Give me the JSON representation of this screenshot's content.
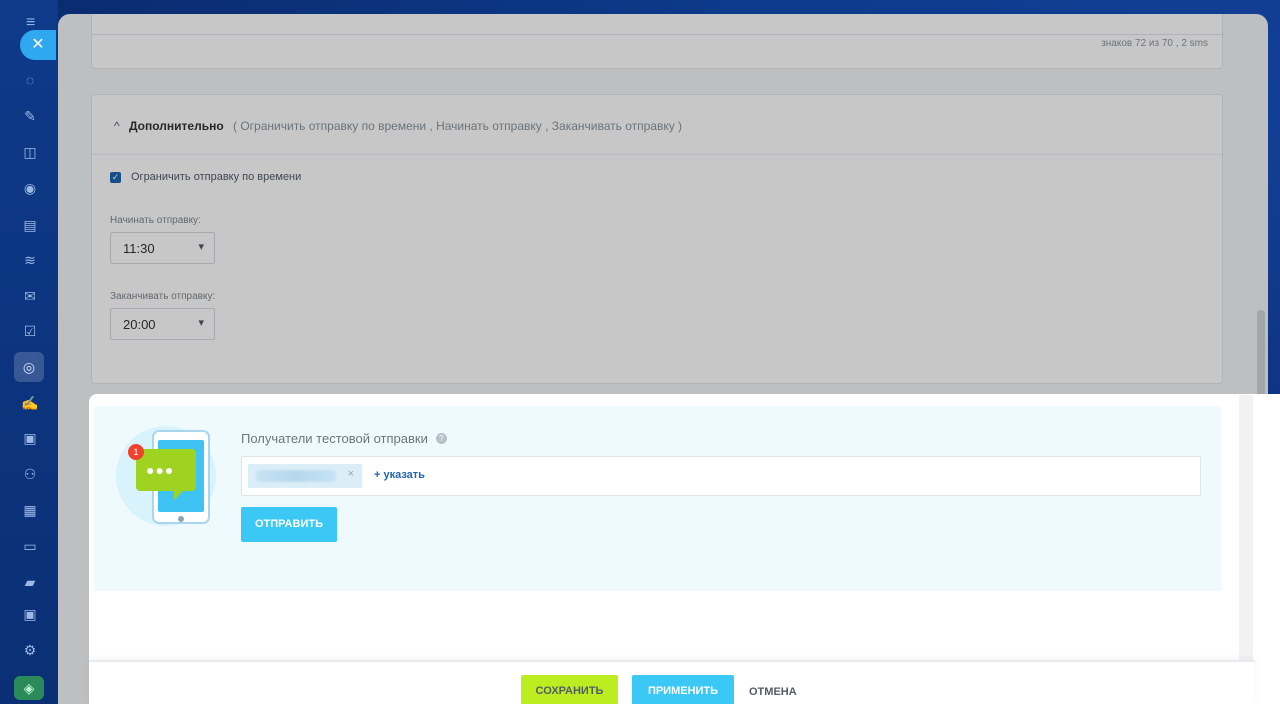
{
  "rail": {
    "menu_icon": "≡",
    "close_icon": "✕",
    "icons": [
      "◌",
      "✎",
      "◫",
      "◉",
      "▤",
      "≋",
      "✉",
      "☑",
      "◎",
      "✍",
      "▣",
      "⚇",
      "▦",
      "▭",
      "▰",
      "▣",
      "⚙",
      "◈"
    ]
  },
  "sms": {
    "counter": "знаков 72 из 70 , 2 sms"
  },
  "extra": {
    "title": "Дополнительно",
    "hint": "( Ограничить отправку по времени ,  Начинать отправку ,  Заканчивать отправку )",
    "limit_checkbox_label": "Ограничить отправку по времени",
    "start_label": "Начинать отправку:",
    "start_value": "11:30",
    "end_label": "Заканчивать отправку:",
    "end_value": "20:00"
  },
  "test": {
    "title": "Получатели тестовой отправки",
    "help": "?",
    "badge": "1",
    "add_link": "+ указать",
    "remove": "×",
    "send_button": "ОТПРАВИТЬ"
  },
  "footer": {
    "save": "СОХРАНИТЬ",
    "apply": "ПРИМЕНИТЬ",
    "cancel": "ОТМЕНА"
  }
}
